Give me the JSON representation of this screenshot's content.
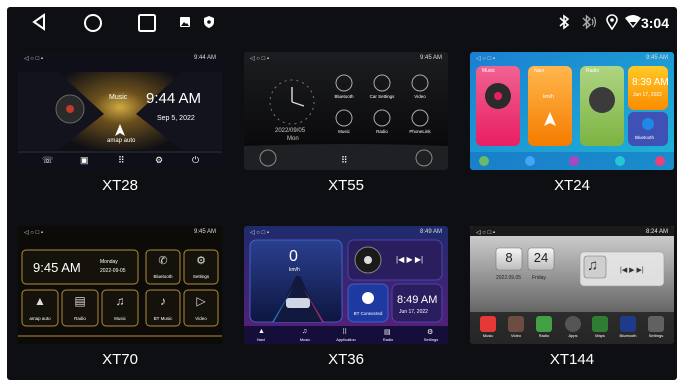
{
  "status_bar": {
    "clock": "3:04",
    "icons": [
      "bluetooth-icon",
      "bluetooth-audio-icon",
      "location-icon",
      "wifi-icon"
    ],
    "nav_buttons": [
      "back-icon",
      "home-icon",
      "recent-apps-icon",
      "gallery-icon",
      "shield-icon"
    ]
  },
  "themes": [
    {
      "name": "XT28",
      "preview": {
        "status_time": "9:44 AM",
        "music_label": "Music",
        "clock": "9:44 AM",
        "date": "Sep 5, 2022",
        "nav_label": "amap auto"
      }
    },
    {
      "name": "XT55",
      "preview": {
        "status_time": "9:45 AM",
        "date": "2022/09/05",
        "weekday": "Mon",
        "apps": [
          "Bluetooth",
          "Car Settings",
          "Video",
          "Music",
          "Radio",
          "PhoneLink"
        ]
      }
    },
    {
      "name": "XT24",
      "preview": {
        "status_time": "9:45 AM",
        "cards": [
          "Music",
          "Navi",
          "Radio"
        ],
        "speed_unit": "km/h",
        "clock": "8:39 AM",
        "date": "Jun 17, 2022",
        "bt_label": "Bluetooth"
      }
    },
    {
      "name": "XT70",
      "preview": {
        "status_time": "9:45 AM",
        "clock": "9:45 AM",
        "weekday": "Monday",
        "date": "2022-09-05",
        "apps": [
          "Bluetooth",
          "Settings",
          "amap auto",
          "Radio",
          "Music",
          "BT Music",
          "Video"
        ]
      }
    },
    {
      "name": "XT36",
      "preview": {
        "status_time": "8:49 AM",
        "speed": "0",
        "speed_unit": "km/h",
        "bt_label": "BT Connected",
        "clock": "8:49 AM",
        "date": "Jun 17, 2022",
        "dock": [
          "Navi",
          "Music",
          "Application",
          "Radio",
          "Settings"
        ]
      }
    },
    {
      "name": "XT144",
      "preview": {
        "status_time": "8:24 AM",
        "hour": "8",
        "minute": "24",
        "date": "2022.09.05",
        "weekday": "Friday",
        "dock": [
          "Music",
          "Video",
          "Radio",
          "Apps",
          "Maps",
          "Bluetooth",
          "Settings"
        ]
      }
    }
  ],
  "colors": {
    "background": "#0d0f12",
    "text": "#ffffff",
    "xt28_accent": "#c9a33a",
    "xt24_accent": "#4fc3f7",
    "xt36_accent": "#3a5bd9",
    "xt144_accent": "#e53935"
  }
}
